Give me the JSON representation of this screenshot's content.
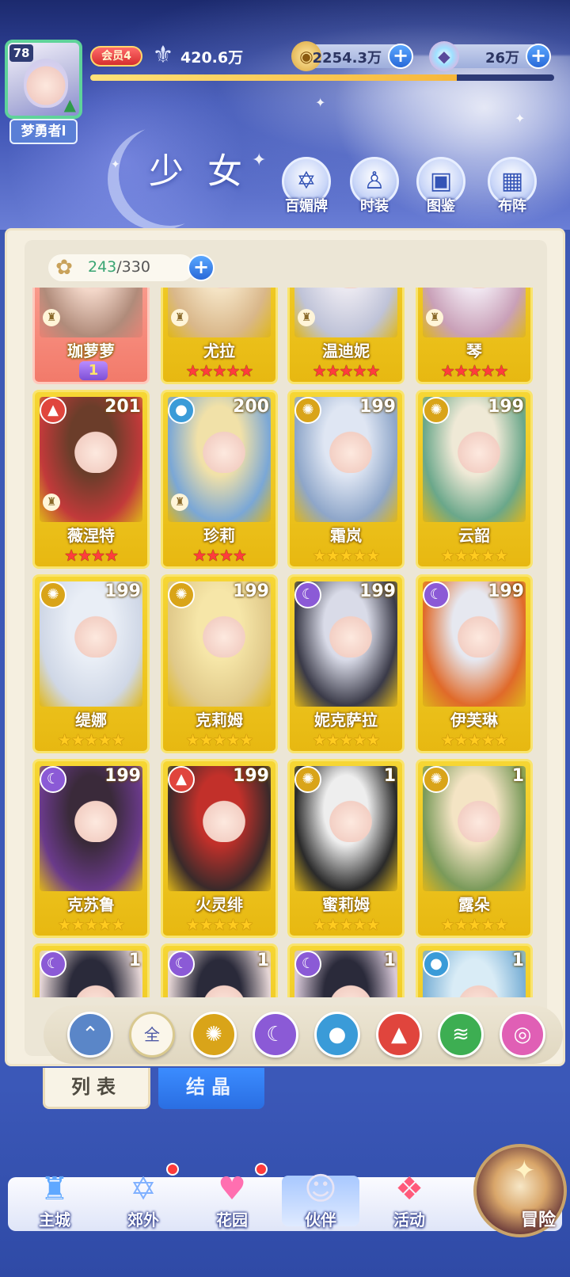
{
  "header": {
    "level": "78",
    "player_name": "梦勇者l",
    "vip_label": "会员4",
    "power": "420.6万",
    "gold": "2254.3万",
    "gems": "26万",
    "exp_percent": 79,
    "page_title": "少女"
  },
  "features": [
    {
      "label": "百媚牌",
      "icon": "charm-card-icon"
    },
    {
      "label": "时装",
      "icon": "outfit-icon"
    },
    {
      "label": "图鉴",
      "icon": "codex-book-icon"
    },
    {
      "label": "布阵",
      "icon": "formation-grid-icon"
    }
  ],
  "capacity": {
    "current": "243",
    "max": "/330"
  },
  "characters": [
    {
      "name": "珈萝萝",
      "element": "",
      "level": "",
      "stars": 0,
      "star_color": "gold",
      "awaken": "1",
      "card_style": "red",
      "rank_icon": true
    },
    {
      "name": "尤拉",
      "element": "",
      "level": "",
      "stars": 5,
      "star_color": "red",
      "card_style": "gold",
      "rank_icon": true
    },
    {
      "name": "温迪妮",
      "element": "",
      "level": "",
      "stars": 5,
      "star_color": "red",
      "card_style": "gold",
      "rank_icon": true
    },
    {
      "name": "琴",
      "element": "",
      "level": "",
      "stars": 5,
      "star_color": "red",
      "card_style": "gold",
      "rank_icon": true
    },
    {
      "name": "薇涅特",
      "element": "fire",
      "level": "201",
      "stars": 4,
      "star_color": "red",
      "card_style": "gold",
      "rank_icon": true
    },
    {
      "name": "珍莉",
      "element": "water",
      "level": "200",
      "stars": 4,
      "star_color": "red",
      "card_style": "gold",
      "rank_icon": true
    },
    {
      "name": "霜岚",
      "element": "light",
      "level": "199",
      "stars": 5,
      "star_color": "gold",
      "card_style": "gold"
    },
    {
      "name": "云韶",
      "element": "light",
      "level": "199",
      "stars": 5,
      "star_color": "gold",
      "card_style": "gold"
    },
    {
      "name": "缇娜",
      "element": "light",
      "level": "199",
      "stars": 5,
      "star_color": "gold",
      "card_style": "gold"
    },
    {
      "name": "克莉姆",
      "element": "light",
      "level": "199",
      "stars": 5,
      "star_color": "gold",
      "card_style": "gold"
    },
    {
      "name": "妮克萨拉",
      "element": "dark",
      "level": "199",
      "stars": 5,
      "star_color": "gold",
      "card_style": "gold"
    },
    {
      "name": "伊芙琳",
      "element": "dark",
      "level": "199",
      "stars": 5,
      "star_color": "gold",
      "card_style": "gold"
    },
    {
      "name": "克苏鲁",
      "element": "dark",
      "level": "199",
      "stars": 5,
      "star_color": "gold",
      "card_style": "gold"
    },
    {
      "name": "火灵绯",
      "element": "fire",
      "level": "199",
      "stars": 5,
      "star_color": "gold",
      "card_style": "gold"
    },
    {
      "name": "蜜莉姆",
      "element": "light",
      "level": "1",
      "stars": 5,
      "star_color": "gold",
      "card_style": "gold"
    },
    {
      "name": "露朵",
      "element": "light",
      "level": "1",
      "stars": 5,
      "star_color": "gold",
      "card_style": "gold"
    },
    {
      "name": "",
      "element": "dark",
      "level": "1",
      "stars": 0,
      "star_color": "gold",
      "card_style": "gold"
    },
    {
      "name": "",
      "element": "dark",
      "level": "1",
      "stars": 0,
      "star_color": "gold",
      "card_style": "gold"
    },
    {
      "name": "",
      "element": "dark",
      "level": "1",
      "stars": 0,
      "star_color": "gold",
      "card_style": "gold"
    },
    {
      "name": "",
      "element": "water",
      "level": "1",
      "stars": 0,
      "star_color": "gold",
      "card_style": "gold"
    }
  ],
  "element_colors": {
    "fire": "#e0453d",
    "water": "#3a9bd8",
    "light": "#d9a419",
    "dark": "#8b5ad6",
    "wind": "#3dae52",
    "arcane": "#e05fb5",
    "air": "#5a86c8"
  },
  "filters": [
    {
      "id": "air",
      "label": "",
      "icon": "wing-icon",
      "color": "#5a86c8"
    },
    {
      "id": "all",
      "label": "全",
      "icon": "all-icon",
      "color": "#fbf6ea"
    },
    {
      "id": "light",
      "label": "",
      "icon": "sun-icon",
      "color": "#d9a419"
    },
    {
      "id": "dark",
      "label": "",
      "icon": "moon-icon",
      "color": "#8b5ad6"
    },
    {
      "id": "water",
      "label": "",
      "icon": "water-drop-icon",
      "color": "#3a9bd8"
    },
    {
      "id": "fire",
      "label": "",
      "icon": "flame-icon",
      "color": "#e0453d"
    },
    {
      "id": "wind",
      "label": "",
      "icon": "tornado-icon",
      "color": "#3dae52"
    },
    {
      "id": "arcane",
      "label": "",
      "icon": "orb-icon",
      "color": "#e05fb5"
    }
  ],
  "tabs": {
    "list": "列表",
    "crystal": "结晶"
  },
  "nav": [
    {
      "label": "主城",
      "icon": "castle-icon",
      "dot": false
    },
    {
      "label": "郊外",
      "icon": "outskirts-icon",
      "dot": true
    },
    {
      "label": "花园",
      "icon": "garden-heart-icon",
      "dot": true
    },
    {
      "label": "伙伴",
      "icon": "partner-icon",
      "dot": false,
      "active": true
    },
    {
      "label": "活动",
      "icon": "gift-icon",
      "dot": false
    },
    {
      "label": "冒险",
      "icon": "adventure-icon",
      "dot": false
    }
  ]
}
